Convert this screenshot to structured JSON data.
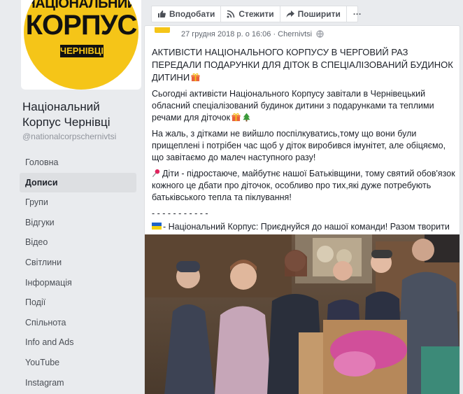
{
  "page": {
    "logo_line1": "НАЦІОНАЛЬНИЙ",
    "logo_line2": "КОРПУС",
    "logo_line3": "ЧЕРНІВЦІ",
    "name": "Національний Корпус Чернівці",
    "handle": "@nationalcorpschernivtsi"
  },
  "nav": [
    {
      "label": "Головна",
      "active": false
    },
    {
      "label": "Дописи",
      "active": true
    },
    {
      "label": "Групи",
      "active": false
    },
    {
      "label": "Відгуки",
      "active": false
    },
    {
      "label": "Відео",
      "active": false
    },
    {
      "label": "Світлини",
      "active": false
    },
    {
      "label": "Інформація",
      "active": false
    },
    {
      "label": "Події",
      "active": false
    },
    {
      "label": "Спільнота",
      "active": false
    },
    {
      "label": "Info and Ads",
      "active": false
    },
    {
      "label": "YouTube",
      "active": false
    },
    {
      "label": "Instagram",
      "active": false
    }
  ],
  "actions": {
    "like": "Вподобати",
    "follow": "Стежити",
    "share": "Поширити",
    "more": "···"
  },
  "post": {
    "meta": "27 грудня 2018 р. о 16:06 · Chernivtsi",
    "headline": "АКТИВІСТИ НАЦІОНАЛЬНОГО КОРПУСУ В ЧЕРГОВИЙ РАЗ ПЕРЕДАЛИ ПОДАРУНКИ ДЛЯ ДІТОК В СПЕЦІАЛІЗОВАНИЙ БУДИНОК ДИТИНИ",
    "p1": "Сьогодні активісти Національного Корпусу завітали в Чернівецький обласний спеціалізований будинок дитини з подарунками та теплими речами для діточок",
    "p2": "На жаль, з дітками не вийшло поспілкуватись,тому що вони були прищеплені і потрібен час щоб у діток виробився імунітет, але обіцяємо, що завітаємо до малеч наступного разу!",
    "p3": "Діти - підростаюче, майбутнє нашої Батьківщини, тому святий обов'язок кожного це дбати про діточок, особливо про тих,які дуже потребують батьківського тепла та піклування!",
    "divider": "- - - - - - - - - - -",
    "p4": "- Національний Корпус: Приєднуйся до нашої команди! Разом творити добро легше!"
  },
  "colors": {
    "brand_yellow": "#f5c518",
    "fb_background": "#e9ebee",
    "nav_active": "#dddfe2"
  },
  "icons": [
    "like-icon",
    "follow-icon",
    "share-icon",
    "globe-icon",
    "gift-emoji",
    "tree-emoji",
    "pin-emoji",
    "ukraine-flag-emoji"
  ]
}
